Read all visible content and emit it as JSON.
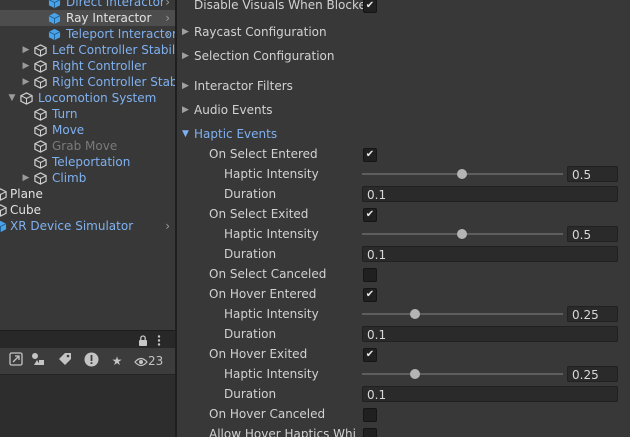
{
  "hierarchy": {
    "items": [
      {
        "label": "Direct Interactor"
      },
      {
        "label": "Ray Interactor"
      },
      {
        "label": "Teleport Interactor"
      },
      {
        "label": "Left Controller Stabilized"
      },
      {
        "label": "Right Controller"
      },
      {
        "label": "Right Controller Stabilized"
      },
      {
        "label": "Locomotion System"
      },
      {
        "label": "Turn"
      },
      {
        "label": "Move"
      },
      {
        "label": "Grab Move"
      },
      {
        "label": "Teleportation"
      },
      {
        "label": "Climb"
      },
      {
        "label": "Plane"
      },
      {
        "label": "Cube"
      },
      {
        "label": "XR Device Simulator"
      }
    ]
  },
  "bottom_panel": {
    "visibility_count": "23"
  },
  "inspector": {
    "disable_visuals_label": "Disable Visuals When Blocked",
    "sections": {
      "raycast": "Raycast Configuration",
      "selection": "Selection Configuration",
      "interactor_filters": "Interactor Filters",
      "audio_events": "Audio Events",
      "haptic_events": "Haptic Events"
    },
    "haptic": {
      "labels": {
        "intensity": "Haptic Intensity",
        "duration": "Duration"
      },
      "events": [
        {
          "label": "On Select Entered",
          "checked": true,
          "intensity": "0.5",
          "duration": "0.1"
        },
        {
          "label": "On Select Exited",
          "checked": true,
          "intensity": "0.5",
          "duration": "0.1"
        },
        {
          "label": "On Select Canceled",
          "checked": false
        },
        {
          "label": "On Hover Entered",
          "checked": true,
          "intensity": "0.25",
          "duration": "0.1"
        },
        {
          "label": "On Hover Exited",
          "checked": true,
          "intensity": "0.25",
          "duration": "0.1"
        },
        {
          "label": "On Hover Canceled",
          "checked": false
        },
        {
          "label": "Allow Hover Haptics While Selecting",
          "checked": false
        }
      ]
    }
  },
  "colors": {
    "link_blue": "#7fb1f0",
    "selection_bg": "#4d4d4d",
    "panel_bg": "#383838"
  }
}
